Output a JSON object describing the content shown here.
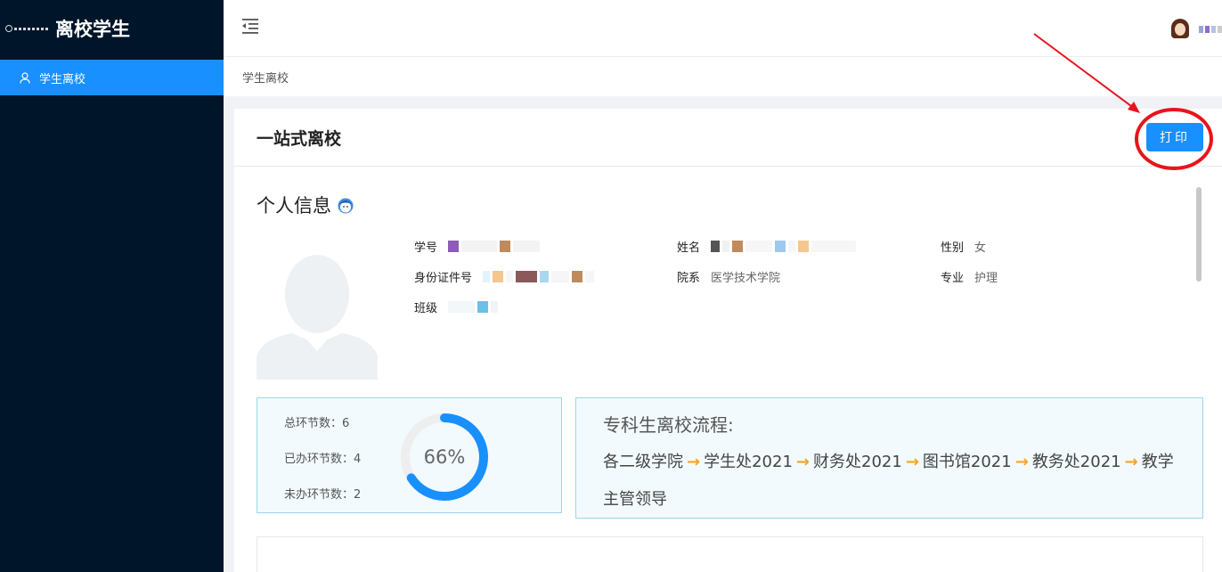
{
  "app": {
    "brand_title": "离校学生"
  },
  "sidebar": {
    "items": [
      {
        "label": "学生离校",
        "icon": "user-icon",
        "active": true
      }
    ]
  },
  "header": {
    "fold_icon": "menu-fold-icon"
  },
  "breadcrumb": {
    "current": "学生离校"
  },
  "card": {
    "title": "一站式离校",
    "print_label": "打印",
    "section_title": "个人信息",
    "info": {
      "student_id_label": "学号",
      "name_label": "姓名",
      "gender_label": "性别",
      "gender_value": "女",
      "id_card_label": "身份证件号",
      "department_label": "院系",
      "department_value": "医学技术学院",
      "major_label": "专业",
      "major_value": "护理",
      "class_label": "班级"
    },
    "stats": {
      "total_label": "总环节数：6",
      "done_label": "已办环节数：4",
      "pending_label": "未办环节数：2",
      "progress_percent": 66,
      "progress_label": "66%"
    },
    "flow": {
      "title": "专科生离校流程:",
      "steps": [
        "各二级学院",
        "学生处2021",
        "财务处2021",
        "图书馆2021",
        "教务处2021",
        "教学主管领导"
      ]
    }
  },
  "colors": {
    "sidebar_bg": "#001529",
    "accent": "#1890ff",
    "annotation": "#e8141b",
    "flow_arrow": "#f5a623"
  }
}
